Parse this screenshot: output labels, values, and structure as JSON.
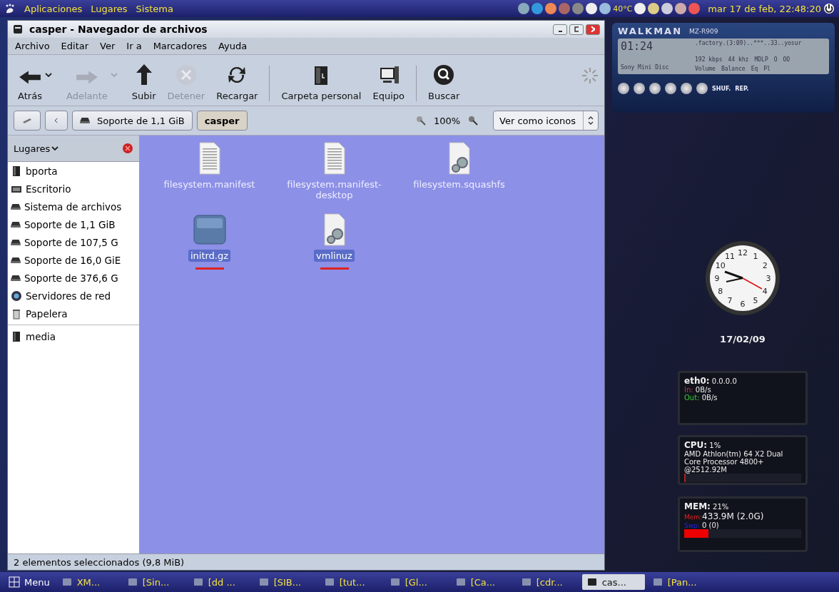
{
  "top_panel": {
    "menus": [
      "Aplicaciones",
      "Lugares",
      "Sistema"
    ],
    "temperature": "40°C",
    "clock": "mar 17 de feb, 22:48:20"
  },
  "window": {
    "title": "casper - Navegador de archivos",
    "menu": [
      "Archivo",
      "Editar",
      "Ver",
      "Ir a",
      "Marcadores",
      "Ayuda"
    ],
    "toolbar": [
      {
        "kind": "button",
        "label": "Atrás",
        "disabled": false,
        "dropdown": true
      },
      {
        "kind": "button",
        "label": "Adelante",
        "disabled": true,
        "dropdown": true
      },
      {
        "kind": "button",
        "label": "Subir",
        "disabled": false,
        "dropdown": false
      },
      {
        "kind": "button",
        "label": "Detener",
        "disabled": true,
        "dropdown": false
      },
      {
        "kind": "button",
        "label": "Recargar",
        "disabled": false,
        "dropdown": false
      },
      {
        "kind": "separator"
      },
      {
        "kind": "button",
        "label": "Carpeta personal",
        "disabled": false,
        "dropdown": false
      },
      {
        "kind": "button",
        "label": "Equipo",
        "disabled": false,
        "dropdown": false
      },
      {
        "kind": "separator"
      },
      {
        "kind": "button",
        "label": "Buscar",
        "disabled": false,
        "dropdown": false
      },
      {
        "kind": "spinner"
      }
    ],
    "location": {
      "path": [
        {
          "label": "Soporte de 1,1 GiB",
          "selected": false
        },
        {
          "label": "casper",
          "selected": true
        }
      ],
      "zoom": "100%",
      "view": "Ver como iconos"
    },
    "sidebar": {
      "title": "Lugares",
      "items": [
        {
          "kind": "home",
          "label": "bporta"
        },
        {
          "kind": "desktop",
          "label": "Escritorio"
        },
        {
          "kind": "drive",
          "label": "Sistema de archivos"
        },
        {
          "kind": "drive",
          "label": "Soporte de 1,1 GiB"
        },
        {
          "kind": "drive",
          "label": "Soporte de 107,5 G"
        },
        {
          "kind": "drive",
          "label": "Soporte de 16,0 GiE"
        },
        {
          "kind": "drive",
          "label": "Soporte de 376,6 G"
        },
        {
          "kind": "network",
          "label": "Servidores de red"
        },
        {
          "kind": "trash",
          "label": "Papelera"
        }
      ],
      "bookmarks": [
        {
          "kind": "folder",
          "label": "media"
        }
      ]
    },
    "files": [
      {
        "kind": "text",
        "name": "filesystem.manifest",
        "selected": false,
        "marked": false
      },
      {
        "kind": "text",
        "name": "filesystem.manifest-desktop",
        "selected": false,
        "marked": false
      },
      {
        "kind": "binary",
        "name": "filesystem.squashfs",
        "selected": false,
        "marked": false
      },
      {
        "kind": "archive",
        "name": "initrd.gz",
        "selected": true,
        "marked": true
      },
      {
        "kind": "binary",
        "name": "vmlinuz",
        "selected": true,
        "marked": true
      }
    ],
    "status": "2 elementos seleccionados (9,8 MiB)"
  },
  "walkman": {
    "logo": "WALKMAN",
    "model": "MZ-R909",
    "time": "01:24",
    "track": ".factory.(3:09)..***..33..yosur",
    "bitrate": "192 kbps",
    "frequency": "44 khz",
    "mode": "MDLP",
    "counter_1": "O",
    "counter_2": "OO",
    "disc": "Sony Mini Disc",
    "volume": "Volume",
    "balance": "Balance",
    "eq": "Eq",
    "pl": "Pl",
    "shuffle": "SHUF.",
    "repeat": "REP."
  },
  "clock": {
    "numbers": [
      "12",
      "11",
      "1",
      "10",
      "2",
      "9",
      "3",
      "8",
      "4",
      "7",
      "5",
      "6"
    ],
    "date": "17/02/09"
  },
  "conky": {
    "net": {
      "title": "eth0:",
      "address": "0.0.0.0",
      "in_label": "In:",
      "in": "0B/s",
      "out_label": "Out:",
      "out": "0B/s"
    },
    "cpu": {
      "title": "CPU:",
      "value": "1%",
      "lines": [
        "AMD Athlon(tm) 64 X2 Dual",
        "Core Processor 4800+",
        "@2512.92M"
      ],
      "level": 0.01
    },
    "mem": {
      "title": "MEM:",
      "value": "21%",
      "mem_label": "Mem:",
      "mem": "433.9M (2.0G)",
      "swap_label": "Swp:",
      "swap": "0 (0)",
      "level": 0.21
    }
  },
  "taskbar": {
    "menu": "Menu",
    "tasks": [
      {
        "label": "XM...",
        "selected": false
      },
      {
        "label": "[Sin...",
        "selected": false
      },
      {
        "label": "[dd ...",
        "selected": false
      },
      {
        "label": "[SIB...",
        "selected": false
      },
      {
        "label": "[tut...",
        "selected": false
      },
      {
        "label": "[Gl...",
        "selected": false
      },
      {
        "label": "[Ca...",
        "selected": false
      },
      {
        "label": "[cdr...",
        "selected": false
      },
      {
        "label": "cas...",
        "selected": true
      },
      {
        "label": "[Pan...",
        "selected": false
      }
    ]
  }
}
